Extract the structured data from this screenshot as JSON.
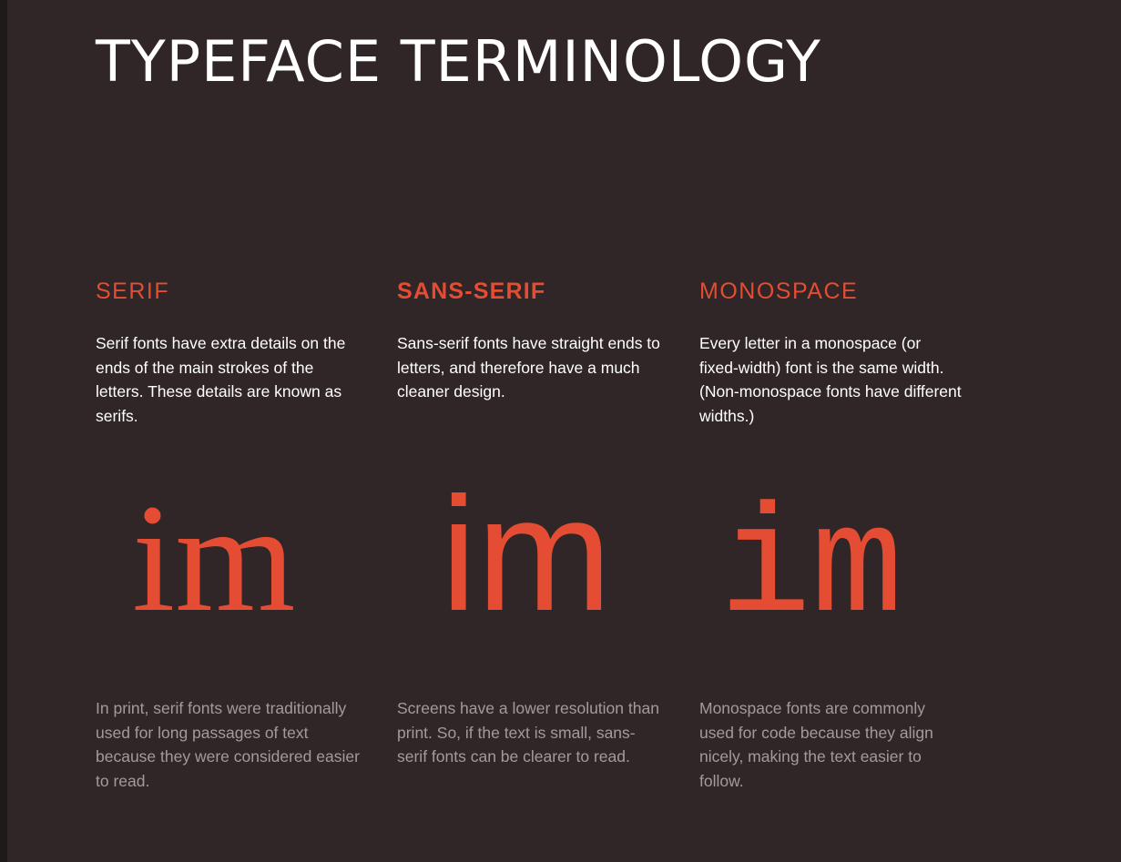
{
  "title": "TYPEFACE TERMINOLOGY",
  "accent_color": "#e44d33",
  "background_color": "#302627",
  "columns": [
    {
      "heading": "SERIF",
      "description": "Serif fonts have extra details on the ends of the main strokes of the letters. These details are known as serifs.",
      "sample": "im",
      "note": "In print, serif fonts were traditionally used for long passages of text because they were considered easier to read."
    },
    {
      "heading": "SANS-SERIF",
      "description": "Sans-serif fonts have straight ends to letters, and therefore have a much cleaner design.",
      "sample": "im",
      "note": "Screens have a lower resolution than print. So, if the text is small, sans-serif fonts can be clearer to read."
    },
    {
      "heading": "MONOSPACE",
      "description": "Every letter in a monospace (or fixed-width) font is the same width. (Non-monospace fonts have different widths.)",
      "sample": "im",
      "note": "Monospace fonts are commonly used for code because they align nicely, making the text easier to follow."
    }
  ]
}
